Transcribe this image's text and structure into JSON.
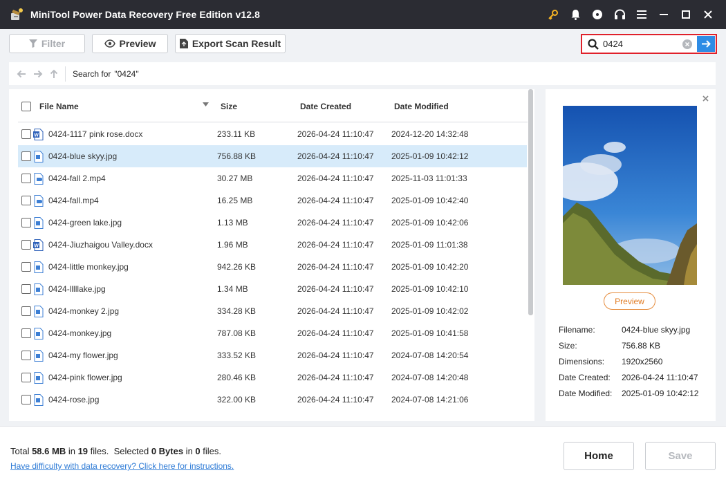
{
  "app": {
    "title": "MiniTool Power Data Recovery Free Edition v12.8"
  },
  "toolbar": {
    "filter_label": "Filter",
    "preview_label": "Preview",
    "export_label": "Export Scan Result"
  },
  "search": {
    "value": "0424"
  },
  "nav": {
    "search_prefix": "Search for",
    "search_term": "\"0424\""
  },
  "table": {
    "headers": {
      "name": "File Name",
      "size": "Size",
      "created": "Date Created",
      "modified": "Date Modified"
    },
    "rows": [
      {
        "name": "0424-1117 pink rose.docx",
        "size": "233.11 KB",
        "created": "2026-04-24 11:10:47",
        "modified": "2024-12-20 14:32:48",
        "icon": "word-doc-icon"
      },
      {
        "name": "0424-blue skyy.jpg",
        "size": "756.88 KB",
        "created": "2026-04-24 11:10:47",
        "modified": "2025-01-09 10:42:12",
        "icon": "image-file-icon"
      },
      {
        "name": "0424-fall 2.mp4",
        "size": "30.27 MB",
        "created": "2026-04-24 11:10:47",
        "modified": "2025-11-03 11:01:33",
        "icon": "video-file-icon"
      },
      {
        "name": "0424-fall.mp4",
        "size": "16.25 MB",
        "created": "2026-04-24 11:10:47",
        "modified": "2025-01-09 10:42:40",
        "icon": "video-file-icon"
      },
      {
        "name": "0424-green lake.jpg",
        "size": "1.13 MB",
        "created": "2026-04-24 11:10:47",
        "modified": "2025-01-09 10:42:06",
        "icon": "image-file-icon"
      },
      {
        "name": "0424-Jiuzhaigou Valley.docx",
        "size": "1.96 MB",
        "created": "2026-04-24 11:10:47",
        "modified": "2025-01-09 11:01:38",
        "icon": "word-doc-icon"
      },
      {
        "name": "0424-little monkey.jpg",
        "size": "942.26 KB",
        "created": "2026-04-24 11:10:47",
        "modified": "2025-01-09 10:42:20",
        "icon": "image-file-icon"
      },
      {
        "name": "0424-lllllake.jpg",
        "size": "1.34 MB",
        "created": "2026-04-24 11:10:47",
        "modified": "2025-01-09 10:42:10",
        "icon": "image-file-icon"
      },
      {
        "name": "0424-monkey 2.jpg",
        "size": "334.28 KB",
        "created": "2026-04-24 11:10:47",
        "modified": "2025-01-09 10:42:02",
        "icon": "image-file-icon"
      },
      {
        "name": "0424-monkey.jpg",
        "size": "787.08 KB",
        "created": "2026-04-24 11:10:47",
        "modified": "2025-01-09 10:41:58",
        "icon": "image-file-icon"
      },
      {
        "name": "0424-my flower.jpg",
        "size": "333.52 KB",
        "created": "2026-04-24 11:10:47",
        "modified": "2024-07-08 14:20:54",
        "icon": "image-file-icon"
      },
      {
        "name": "0424-pink flower.jpg",
        "size": "280.46 KB",
        "created": "2026-04-24 11:10:47",
        "modified": "2024-07-08 14:20:48",
        "icon": "image-file-icon"
      },
      {
        "name": "0424-rose.jpg",
        "size": "322.00 KB",
        "created": "2026-04-24 11:10:47",
        "modified": "2024-07-08 14:21:06",
        "icon": "image-file-icon"
      }
    ]
  },
  "preview": {
    "button_label": "Preview",
    "details": [
      {
        "key": "Filename:",
        "value": "0424-blue skyy.jpg"
      },
      {
        "key": "Size:",
        "value": "756.88 KB"
      },
      {
        "key": "Dimensions:",
        "value": "1920x2560"
      },
      {
        "key": "Date Created:",
        "value": "2026-04-24 11:10:47"
      },
      {
        "key": "Date Modified:",
        "value": "2025-01-09 10:42:12"
      }
    ]
  },
  "footer": {
    "total_prefix": "Total ",
    "total_size": "58.6 MB",
    "in1": " in ",
    "total_count": "19",
    "files1": " files.",
    "selected_prefix": "  Selected ",
    "selected_size": "0 Bytes",
    "in2": " in ",
    "selected_count": "0",
    "files2": " files.",
    "help_link": "Have difficulty with data recovery? Click here for instructions.",
    "home_label": "Home",
    "save_label": "Save"
  },
  "colors": {
    "titlebar": "#2b2c33",
    "accent": "#2e8ce5",
    "search_border": "#e0212b",
    "selected_row": "#d7ebfa",
    "preview_button": "#e07a20"
  }
}
